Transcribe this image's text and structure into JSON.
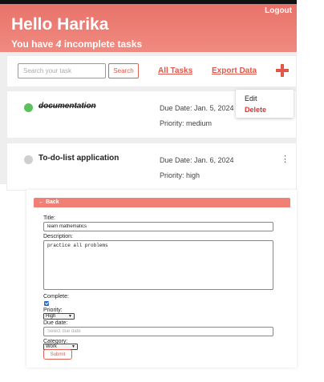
{
  "header": {
    "greeting": "Hello Harika",
    "subtitle_prefix": "You have ",
    "incomplete_count": "4",
    "subtitle_suffix": " incomplete tasks",
    "logout_label": "Logout"
  },
  "toolbar": {
    "search_placeholder": "Search your task",
    "search_button": "Search",
    "all_tasks_link": "All Tasks",
    "export_link": "Export Data",
    "add_icon": "plus-icon"
  },
  "tasks": [
    {
      "title": "documentation",
      "completed": true,
      "due": "Due Date: Jan. 5, 2024",
      "priority": "Priority: medium",
      "status_color": "#5cc05c"
    },
    {
      "title": "To-do-list application",
      "completed": false,
      "due": "Due Date: Jan. 6, 2024",
      "priority": "Priority: high",
      "status_color": "#cfcfcf"
    }
  ],
  "task_menu": {
    "edit_label": "Edit",
    "delete_label": "Delete"
  },
  "form": {
    "back_label": "← Back",
    "title_label": "Title:",
    "title_value": "learn mathematics",
    "description_label": "Description:",
    "description_value": "practice all problems",
    "complete_label": "Complete:",
    "complete_checked": true,
    "priority_label": "Priority:",
    "priority_value": "High",
    "due_label": "Due date:",
    "due_placeholder": "Select due date",
    "category_label": "Category:",
    "category_value": "Work",
    "submit_label": "Submit"
  },
  "colors": {
    "accent": "#e0574c",
    "header_gradient_top": "#e8736b",
    "header_gradient_bottom": "#f08a80"
  }
}
